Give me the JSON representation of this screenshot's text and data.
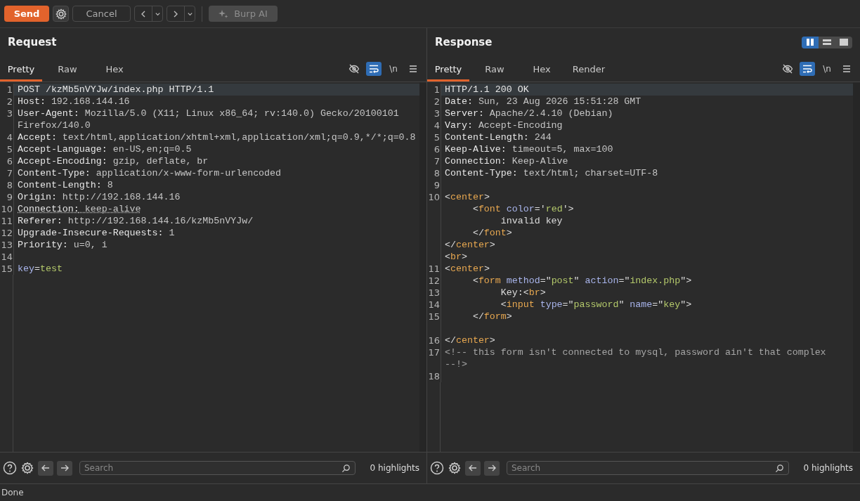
{
  "toolbar": {
    "send": "Send",
    "cancel": "Cancel",
    "burp_ai": {
      "label": "Burp AI",
      "disabled": true
    }
  },
  "panels": [
    {
      "title": "Request",
      "tabs": [
        {
          "label": "Pretty",
          "selected": true
        },
        {
          "label": "Raw",
          "selected": false
        },
        {
          "label": "Hex",
          "selected": false
        }
      ],
      "view_toggles": [
        {
          "kind": "eye",
          "on": false
        },
        {
          "kind": "wrap",
          "on": true
        },
        {
          "kind": "newline",
          "label": "\\n",
          "on": false
        },
        {
          "kind": "menu",
          "on": false
        }
      ],
      "lines": [
        {
          "n": "1",
          "current": true,
          "parts": [
            {
              "kind": "name",
              "text": "POST /kzMb5nVYJw/index.php HTTP/1.1"
            }
          ]
        },
        {
          "n": "2",
          "current": false,
          "parts": [
            {
              "kind": "name",
              "text": "Host:"
            },
            {
              "kind": "value",
              "text": " 192.168.144.16"
            }
          ]
        },
        {
          "n": "3",
          "current": false,
          "parts": [
            {
              "kind": "name",
              "text": "User-Agent:"
            },
            {
              "kind": "value",
              "text": " Mozilla/5.0 (X11; Linux x86_64; rv:140.0) Gecko/20100101"
            }
          ]
        },
        {
          "current": false,
          "parts": [
            {
              "kind": "value",
              "text": "Firefox/140.0"
            }
          ]
        },
        {
          "n": "4",
          "current": false,
          "parts": [
            {
              "kind": "name",
              "text": "Accept:"
            },
            {
              "kind": "value",
              "text": " text/html,application/xhtml+xml,application/xml;q=0.9,*/*;q=0.8"
            }
          ]
        },
        {
          "n": "5",
          "current": false,
          "parts": [
            {
              "kind": "name",
              "text": "Accept-Language:"
            },
            {
              "kind": "value",
              "text": " en-US,en;q=0.5"
            }
          ]
        },
        {
          "n": "6",
          "current": false,
          "parts": [
            {
              "kind": "name",
              "text": "Accept-Encoding:"
            },
            {
              "kind": "value",
              "text": " gzip, deflate, br"
            }
          ]
        },
        {
          "n": "7",
          "current": false,
          "parts": [
            {
              "kind": "name",
              "text": "Content-Type:"
            },
            {
              "kind": "value",
              "text": " application/x-www-form-urlencoded"
            }
          ]
        },
        {
          "n": "8",
          "current": false,
          "parts": [
            {
              "kind": "name",
              "text": "Content-Length:"
            },
            {
              "kind": "value",
              "text": " 8"
            }
          ]
        },
        {
          "n": "9",
          "current": false,
          "parts": [
            {
              "kind": "name",
              "text": "Origin:"
            },
            {
              "kind": "value",
              "text": " http://192.168.144.16"
            }
          ]
        },
        {
          "n": "10",
          "current": false,
          "underlined": true,
          "parts": [
            {
              "kind": "name",
              "text": "Connection:"
            },
            {
              "kind": "value",
              "text": " keep-alive"
            }
          ]
        },
        {
          "n": "11",
          "current": false,
          "parts": [
            {
              "kind": "name",
              "text": "Referer:"
            },
            {
              "kind": "value",
              "text": " http://192.168.144.16/kzMb5nVYJw/"
            }
          ]
        },
        {
          "n": "12",
          "current": false,
          "parts": [
            {
              "kind": "name",
              "text": "Upgrade-Insecure-Requests:"
            },
            {
              "kind": "value",
              "text": " 1"
            }
          ]
        },
        {
          "n": "13",
          "current": false,
          "parts": [
            {
              "kind": "name",
              "text": "Priority:"
            },
            {
              "kind": "value",
              "text": " u=0, i"
            }
          ]
        },
        {
          "n": "14",
          "current": false
        },
        {
          "n": "15",
          "current": false,
          "parts": [
            {
              "kind": "attr",
              "text": "key"
            },
            {
              "kind": "punct",
              "text": "="
            },
            {
              "kind": "string",
              "text": "test"
            }
          ]
        }
      ],
      "search": {
        "placeholder": "Search"
      },
      "highlights": "0 highlights"
    },
    {
      "title": "Response",
      "layout_toggles": [
        {
          "kind": "columns",
          "selected": true
        },
        {
          "kind": "rows",
          "selected": false
        },
        {
          "kind": "single",
          "selected": false
        }
      ],
      "tabs": [
        {
          "label": "Pretty",
          "selected": true
        },
        {
          "label": "Raw",
          "selected": false
        },
        {
          "label": "Hex",
          "selected": false
        },
        {
          "label": "Render",
          "selected": false
        }
      ],
      "view_toggles": [
        {
          "kind": "eye",
          "on": false
        },
        {
          "kind": "wrap",
          "on": true
        },
        {
          "kind": "newline",
          "label": "\\n",
          "on": false
        },
        {
          "kind": "menu",
          "on": false
        }
      ],
      "lines": [
        {
          "n": "1",
          "current": true,
          "parts": [
            {
              "kind": "name",
              "text": "HTTP/1.1 200 OK"
            }
          ]
        },
        {
          "n": "2",
          "current": false,
          "parts": [
            {
              "kind": "name",
              "text": "Date:"
            },
            {
              "kind": "value",
              "text": " Sun, 23 Aug 2026 15:51:28 GMT"
            }
          ]
        },
        {
          "n": "3",
          "current": false,
          "parts": [
            {
              "kind": "name",
              "text": "Server:"
            },
            {
              "kind": "value",
              "text": " Apache/2.4.10 (Debian)"
            }
          ]
        },
        {
          "n": "4",
          "current": false,
          "parts": [
            {
              "kind": "name",
              "text": "Vary:"
            },
            {
              "kind": "value",
              "text": " Accept-Encoding"
            }
          ]
        },
        {
          "n": "5",
          "current": false,
          "parts": [
            {
              "kind": "name",
              "text": "Content-Length:"
            },
            {
              "kind": "value",
              "text": " 244"
            }
          ]
        },
        {
          "n": "6",
          "current": false,
          "parts": [
            {
              "kind": "name",
              "text": "Keep-Alive:"
            },
            {
              "kind": "value",
              "text": " timeout=5, max=100"
            }
          ]
        },
        {
          "n": "7",
          "current": false,
          "parts": [
            {
              "kind": "name",
              "text": "Connection:"
            },
            {
              "kind": "value",
              "text": " Keep-Alive"
            }
          ]
        },
        {
          "n": "8",
          "current": false,
          "parts": [
            {
              "kind": "name",
              "text": "Content-Type:"
            },
            {
              "kind": "value",
              "text": " text/html; charset=UTF-8"
            }
          ]
        },
        {
          "n": "9",
          "current": false
        },
        {
          "n": "10",
          "current": false,
          "parts": [
            {
              "kind": "punct",
              "text": "<"
            },
            {
              "kind": "tag",
              "text": "center"
            },
            {
              "kind": "punct",
              "text": ">"
            }
          ]
        },
        {
          "current": false,
          "parts": [
            {
              "kind": "punct",
              "text": "     <"
            },
            {
              "kind": "tag",
              "text": "font"
            },
            {
              "kind": "attr",
              "text": " color"
            },
            {
              "kind": "punct",
              "text": "='"
            },
            {
              "kind": "string",
              "text": "red"
            },
            {
              "kind": "punct",
              "text": "'>"
            }
          ]
        },
        {
          "current": false,
          "parts": [
            {
              "kind": "punct",
              "text": "          invalid key"
            }
          ]
        },
        {
          "current": false,
          "parts": [
            {
              "kind": "punct",
              "text": "     </"
            },
            {
              "kind": "tag",
              "text": "font"
            },
            {
              "kind": "punct",
              "text": ">"
            }
          ]
        },
        {
          "current": false,
          "parts": [
            {
              "kind": "punct",
              "text": "</"
            },
            {
              "kind": "tag",
              "text": "center"
            },
            {
              "kind": "punct",
              "text": ">"
            }
          ]
        },
        {
          "current": false,
          "parts": [
            {
              "kind": "punct",
              "text": "<"
            },
            {
              "kind": "tag",
              "text": "br"
            },
            {
              "kind": "punct",
              "text": ">"
            }
          ]
        },
        {
          "n": "11",
          "current": false,
          "parts": [
            {
              "kind": "punct",
              "text": "<"
            },
            {
              "kind": "tag",
              "text": "center"
            },
            {
              "kind": "punct",
              "text": ">"
            }
          ]
        },
        {
          "n": "12",
          "current": false,
          "parts": [
            {
              "kind": "punct",
              "text": "     <"
            },
            {
              "kind": "tag",
              "text": "form"
            },
            {
              "kind": "attr",
              "text": " method"
            },
            {
              "kind": "punct",
              "text": "=\""
            },
            {
              "kind": "string",
              "text": "post"
            },
            {
              "kind": "punct",
              "text": "\""
            },
            {
              "kind": "attr",
              "text": " action"
            },
            {
              "kind": "punct",
              "text": "=\""
            },
            {
              "kind": "string",
              "text": "index.php"
            },
            {
              "kind": "punct",
              "text": "\">"
            }
          ]
        },
        {
          "n": "13",
          "current": false,
          "parts": [
            {
              "kind": "punct",
              "text": "          Key:<"
            },
            {
              "kind": "tag",
              "text": "br"
            },
            {
              "kind": "punct",
              "text": ">"
            }
          ]
        },
        {
          "n": "14",
          "current": false,
          "parts": [
            {
              "kind": "punct",
              "text": "          <"
            },
            {
              "kind": "tag",
              "text": "input"
            },
            {
              "kind": "attr",
              "text": " type"
            },
            {
              "kind": "punct",
              "text": "=\""
            },
            {
              "kind": "string",
              "text": "password"
            },
            {
              "kind": "punct",
              "text": "\""
            },
            {
              "kind": "attr",
              "text": " name"
            },
            {
              "kind": "punct",
              "text": "=\""
            },
            {
              "kind": "string",
              "text": "key"
            },
            {
              "kind": "punct",
              "text": "\">"
            }
          ]
        },
        {
          "n": "15",
          "current": false,
          "parts": [
            {
              "kind": "punct",
              "text": "     </"
            },
            {
              "kind": "tag",
              "text": "form"
            },
            {
              "kind": "punct",
              "text": ">"
            }
          ]
        },
        {
          "current": false
        },
        {
          "n": "16",
          "current": false,
          "parts": [
            {
              "kind": "punct",
              "text": "</"
            },
            {
              "kind": "tag",
              "text": "center"
            },
            {
              "kind": "punct",
              "text": ">"
            }
          ]
        },
        {
          "n": "17",
          "current": false,
          "parts": [
            {
              "kind": "comment",
              "text": "<!-- this form isn't connected to mysql, password ain't that complex"
            }
          ]
        },
        {
          "current": false,
          "parts": [
            {
              "kind": "comment",
              "text": "--!>"
            }
          ]
        },
        {
          "n": "18",
          "current": false
        }
      ],
      "search": {
        "placeholder": "Search"
      },
      "highlights": "0 highlights"
    }
  ],
  "status_bar": "Done"
}
